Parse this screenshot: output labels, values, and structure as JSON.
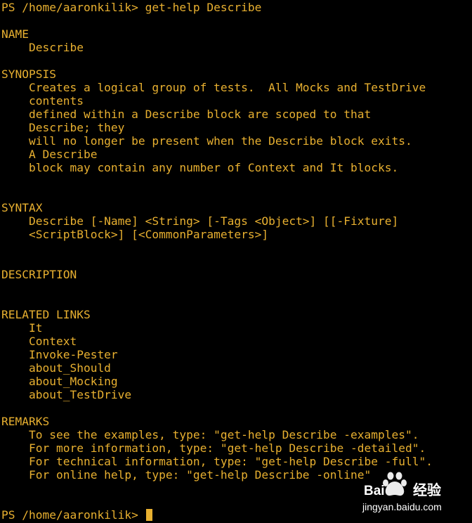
{
  "terminal": {
    "lines": [
      "PS /home/aaronkilik> get-help Describe",
      "",
      "NAME",
      "    Describe",
      "",
      "SYNOPSIS",
      "    Creates a logical group of tests.  All Mocks and TestDrive",
      "    contents",
      "    defined within a Describe block are scoped to that",
      "    Describe; they",
      "    will no longer be present when the Describe block exits.",
      "    A Describe",
      "    block may contain any number of Context and It blocks.",
      "",
      "",
      "SYNTAX",
      "    Describe [-Name] <String> [-Tags <Object>] [[-Fixture]",
      "    <ScriptBlock>] [<CommonParameters>]",
      "",
      "",
      "DESCRIPTION",
      "",
      "",
      "RELATED LINKS",
      "    It",
      "    Context",
      "    Invoke-Pester",
      "    about_Should",
      "    about_Mocking",
      "    about_TestDrive",
      "",
      "REMARKS",
      "    To see the examples, type: \"get-help Describe -examples\".",
      "    For more information, type: \"get-help Describe -detailed\".",
      "    For technical information, type: \"get-help Describe -full\".",
      "    For online help, type: \"get-help Describe -online\"",
      "",
      ""
    ],
    "prompt": "PS /home/aaronkilik> "
  },
  "colors": {
    "background": "#000000",
    "foreground": "#e8b030",
    "watermark": "#ffffff"
  },
  "watermark": {
    "icon": "baidu-paw-icon",
    "brand_text": "Bai",
    "brand_text2": "经验",
    "url": "jingyan.baidu.com"
  }
}
